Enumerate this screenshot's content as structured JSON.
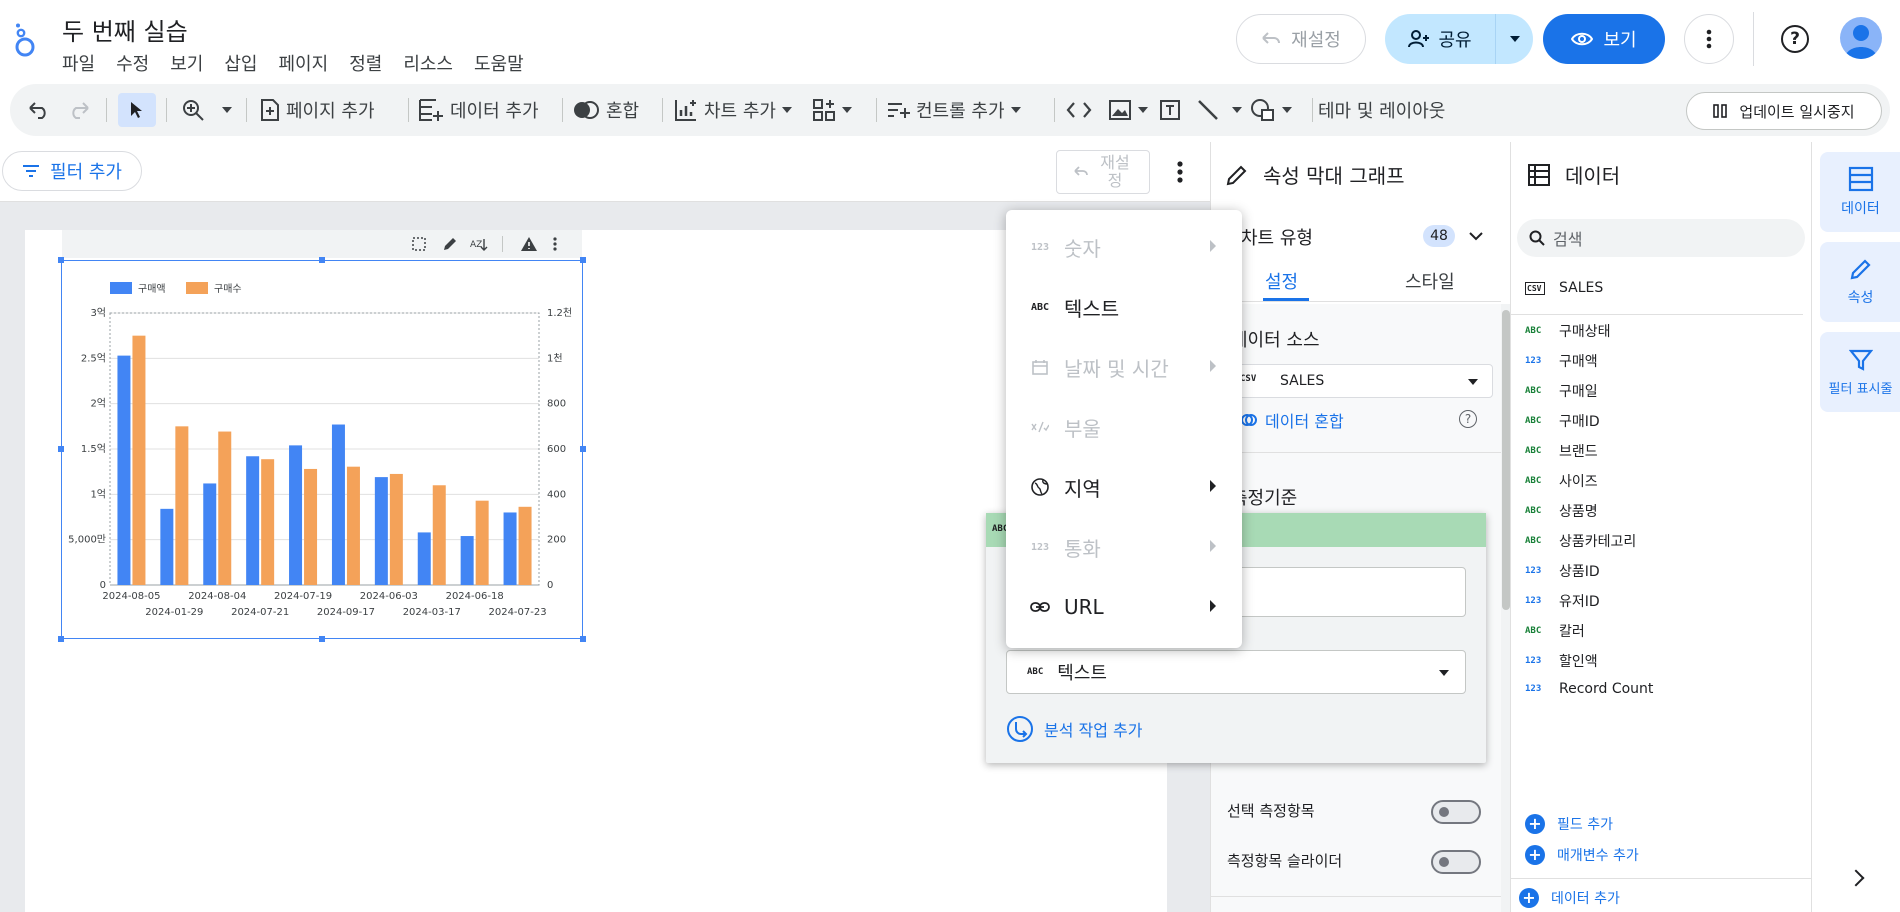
{
  "app": {
    "title": "두 번째 실습",
    "menus": [
      "파일",
      "수정",
      "보기",
      "삽입",
      "페이지",
      "정렬",
      "리소스",
      "도움말"
    ],
    "reset_label": "재설정",
    "share_label": "공유",
    "view_label": "보기",
    "accent": "#1a73e8"
  },
  "toolbar": {
    "add_page": "페이지 추가",
    "add_data": "데이터 추가",
    "blend": "혼합",
    "add_chart": "차트 추가",
    "add_control": "컨트롤 추가",
    "theme_layout": "테마 및 레이아웃",
    "pause_updates": "업데이트 일시중지"
  },
  "canvas": {
    "add_filter": "필터 추가",
    "reset_label": "재설정"
  },
  "chart_data": {
    "type": "bar",
    "series": [
      {
        "name": "구매액",
        "color": "#4285f4",
        "axis": "left",
        "values": [
          2.53,
          0.84,
          1.12,
          1.42,
          1.54,
          1.77,
          1.19,
          0.58,
          0.54,
          0.8
        ]
      },
      {
        "name": "구매수",
        "color": "#f4a259",
        "axis": "right",
        "values": [
          1100,
          700,
          677,
          555,
          512,
          522,
          490,
          440,
          372,
          345
        ]
      }
    ],
    "categories_row1": [
      "2024-08-05",
      "2024-08-04",
      "2024-07-19",
      "2024-06-03",
      "2024-06-18"
    ],
    "categories_row2": [
      "2024-01-29",
      "2024-07-21",
      "2024-09-17",
      "2024-03-17",
      "2024-07-23"
    ],
    "left_ticks": [
      "0",
      "5,000만",
      "1억",
      "1.5억",
      "2억",
      "2.5억",
      "3억"
    ],
    "right_ticks": [
      "0",
      "200",
      "400",
      "600",
      "800",
      "1천",
      "1.2천"
    ],
    "ylim_left": [
      0,
      3
    ],
    "ylim_right": [
      0,
      1200
    ],
    "legend_position": "top-left",
    "grid": true
  },
  "props": {
    "title": "속성 막대 그래프",
    "chart_type_label": "차트 유형",
    "chart_type_count": "48",
    "tab_setting": "설정",
    "tab_style": "스타일",
    "data_source_label": "데이터 소스",
    "data_source_value": "SALES",
    "data_blend": "데이터 혼합",
    "dimension_label": "측정기준",
    "optional_metric": "선택 측정항목",
    "metric_slider": "측정항목 슬라이더"
  },
  "field_popup": {
    "type_value": "텍스트",
    "type_icon": "ABC",
    "add_calc": "분석 작업 추가"
  },
  "type_menu": [
    {
      "icon": "123",
      "label": "숫자",
      "enabled": false,
      "submenu": true
    },
    {
      "icon": "ABC",
      "label": "텍스트",
      "enabled": true,
      "submenu": false
    },
    {
      "icon": "calendar-icon",
      "label": "날짜 및 시간",
      "enabled": false,
      "submenu": true
    },
    {
      "icon": "boolean-icon",
      "label": "부울",
      "enabled": false,
      "submenu": false
    },
    {
      "icon": "globe-icon",
      "label": "지역",
      "enabled": true,
      "submenu": true
    },
    {
      "icon": "123",
      "label": "통화",
      "enabled": false,
      "submenu": true
    },
    {
      "icon": "link-icon",
      "label": "URL",
      "enabled": true,
      "submenu": true
    }
  ],
  "data_panel": {
    "title": "데이터",
    "search_placeholder": "검색",
    "source_icon": "CSV",
    "source_name": "SALES",
    "fields": [
      {
        "type": "ABC",
        "name": "구매상태"
      },
      {
        "type": "123",
        "name": "구매액"
      },
      {
        "type": "ABC",
        "name": "구매일"
      },
      {
        "type": "ABC",
        "name": "구매ID"
      },
      {
        "type": "ABC",
        "name": "브랜드"
      },
      {
        "type": "ABC",
        "name": "사이즈"
      },
      {
        "type": "ABC",
        "name": "상품명"
      },
      {
        "type": "ABC",
        "name": "상품카테고리"
      },
      {
        "type": "123",
        "name": "상품ID"
      },
      {
        "type": "123",
        "name": "유저ID"
      },
      {
        "type": "ABC",
        "name": "칼러"
      },
      {
        "type": "123",
        "name": "할인액"
      },
      {
        "type": "123",
        "name": "Record Count"
      }
    ],
    "add_field": "필드 추가",
    "add_param": "매개변수 추가",
    "add_data": "데이터 추가"
  },
  "rail": {
    "data": "데이터",
    "props": "속성",
    "filter": "필터 표시줄"
  }
}
